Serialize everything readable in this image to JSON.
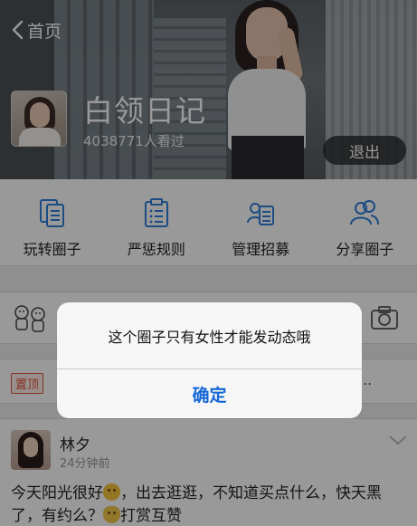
{
  "header": {
    "back_label": "首页",
    "circle_title": "白领日记",
    "views_text": "4038771人看过",
    "exit_label": "退出"
  },
  "nav": {
    "items": [
      {
        "label": "玩转圈子",
        "icon": "copy-doc-icon"
      },
      {
        "label": "严惩规则",
        "icon": "clipboard-list-icon"
      },
      {
        "label": "管理招募",
        "icon": "user-card-icon"
      },
      {
        "label": "分享圈子",
        "icon": "two-users-icon"
      }
    ]
  },
  "pinned": {
    "tag": "置顶",
    "ellipsis": "..."
  },
  "post": {
    "author": "林夕",
    "time": "24分钟前",
    "text_part1": "今天阳光很好",
    "text_part2": "，出去逛逛，不知道买点什么，快天黑了，有约么？",
    "text_part3": "打赏互赞"
  },
  "alert": {
    "message": "这个圈子只有女性才能发动态哦",
    "confirm_label": "确定"
  },
  "colors": {
    "accent_blue": "#1466d6",
    "icon_blue": "#2f7fd9",
    "pin_red": "#e0533b",
    "overlay": "rgba(0,0,0,0.40)"
  }
}
